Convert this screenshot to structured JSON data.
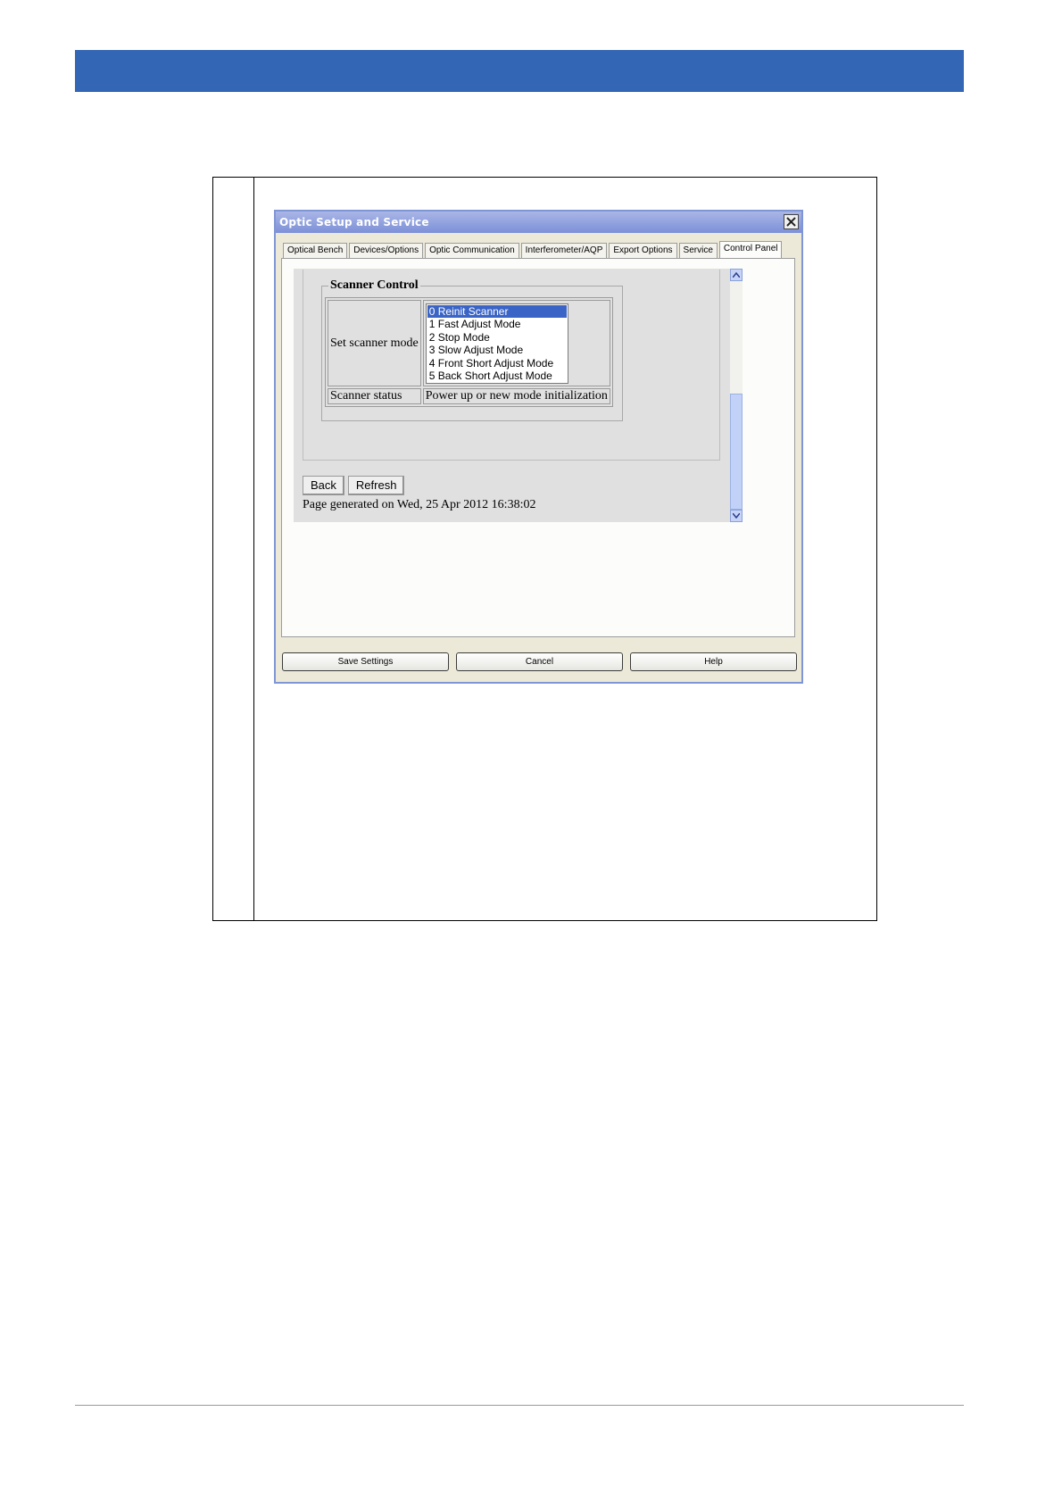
{
  "dialog": {
    "title": "Optic Setup and Service",
    "tabs": [
      {
        "label": "Optical Bench"
      },
      {
        "label": "Devices/Options"
      },
      {
        "label": "Optic Communication"
      },
      {
        "label": "Interferometer/AQP"
      },
      {
        "label": "Export Options"
      },
      {
        "label": "Service"
      },
      {
        "label": "Control Panel",
        "active": true
      }
    ],
    "buttons": {
      "save": "Save Settings",
      "cancel": "Cancel",
      "help": "Help"
    }
  },
  "scanner_control": {
    "legend": "Scanner Control",
    "mode_label": "Set scanner mode",
    "modes": [
      "0 Reinit Scanner",
      "1 Fast Adjust Mode",
      "2 Stop Mode",
      "3 Slow Adjust Mode",
      "4 Front Short Adjust Mode",
      "5 Back Short Adjust Mode"
    ],
    "selected_mode": "0 Reinit Scanner",
    "status_label": "Scanner status",
    "status_value": "Power up or new mode initialization"
  },
  "page": {
    "back_label": "Back",
    "refresh_label": "Refresh",
    "generated_text": "Page generated on Wed, 25 Apr 2012 16:38:02"
  },
  "colors": {
    "header_bar": "#3366b5",
    "selection": "#3a64c5"
  }
}
